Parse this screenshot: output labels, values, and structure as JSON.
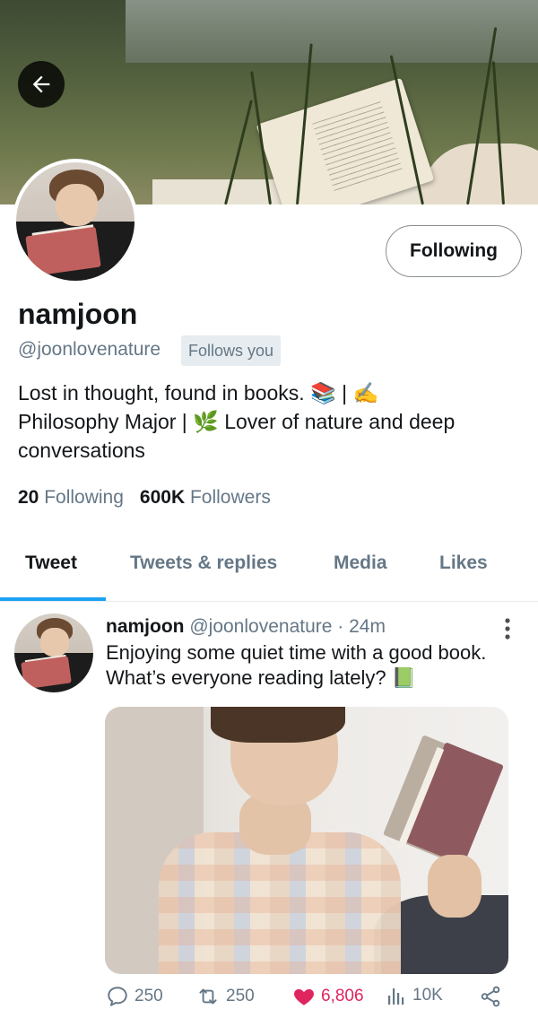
{
  "profile": {
    "follow_button": "Following",
    "display_name": "namjoon",
    "handle": "@joonlovenature",
    "follows_you": "Follows you",
    "bio_lines": [
      "Lost in thought, found in books. 📚 | ✍️",
      "Philosophy Major | 🌿 Lover of nature and deep",
      "conversations"
    ],
    "following_count": "20",
    "following_label": "Following",
    "followers_count": "600K",
    "followers_label": "Followers"
  },
  "tabs": [
    {
      "label": "Tweet",
      "active": true
    },
    {
      "label": "Tweets & replies",
      "active": false
    },
    {
      "label": "Media",
      "active": false
    },
    {
      "label": "Likes",
      "active": false
    }
  ],
  "tweet": {
    "name": "namjoon",
    "handle": "@joonlovenature",
    "separator": "·",
    "time": "24m",
    "text_lines": [
      "Enjoying some quiet time with a good book.",
      "What’s everyone reading lately? 📗"
    ],
    "replies": "250",
    "retweets": "250",
    "likes": "6,806",
    "views": "10K"
  },
  "colors": {
    "accent": "#1da1f2",
    "like": "#e0245e",
    "secondary_text": "#657786"
  },
  "icons": [
    "back-arrow-icon",
    "more-vertical-icon",
    "reply-icon",
    "retweet-icon",
    "heart-icon",
    "views-icon",
    "share-icon"
  ]
}
